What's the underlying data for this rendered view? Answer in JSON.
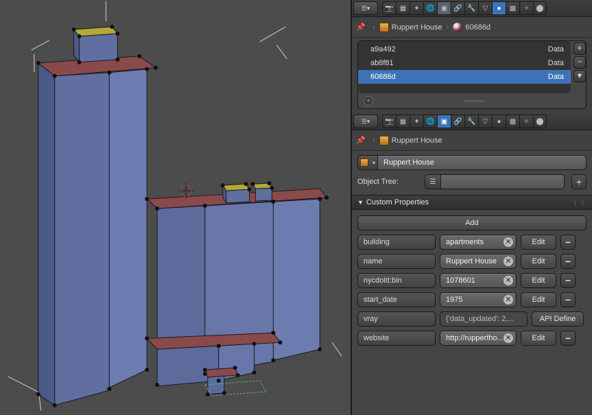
{
  "breadcrumb_upper": {
    "object": "Ruppert House",
    "data": "60686d"
  },
  "materials": [
    {
      "name": "a9a492",
      "kind": "Data",
      "selected": false
    },
    {
      "name": "ab8f81",
      "kind": "Data",
      "selected": false
    },
    {
      "name": "60686d",
      "kind": "Data",
      "selected": true
    }
  ],
  "breadcrumb_lower": {
    "object": "Ruppert House"
  },
  "object_name": "Ruppert House",
  "object_tree_label": "Object Tree:",
  "custom_properties_header": "Custom Properties",
  "add_label": "Add",
  "edit_label": "Edit",
  "api_define_label": "API Define",
  "props": [
    {
      "key": "building",
      "value": "apartments",
      "editable": true
    },
    {
      "key": "name",
      "value": "Ruppert House",
      "editable": true
    },
    {
      "key": "nycdoitt:bin",
      "value": "1078601",
      "editable": true
    },
    {
      "key": "start_date",
      "value": "1975",
      "editable": true
    },
    {
      "key": "vray",
      "value": "{'data_updated': 2,...",
      "editable": false
    },
    {
      "key": "website",
      "value": "http://ruppertho...",
      "editable": true
    }
  ],
  "chart_data": null
}
